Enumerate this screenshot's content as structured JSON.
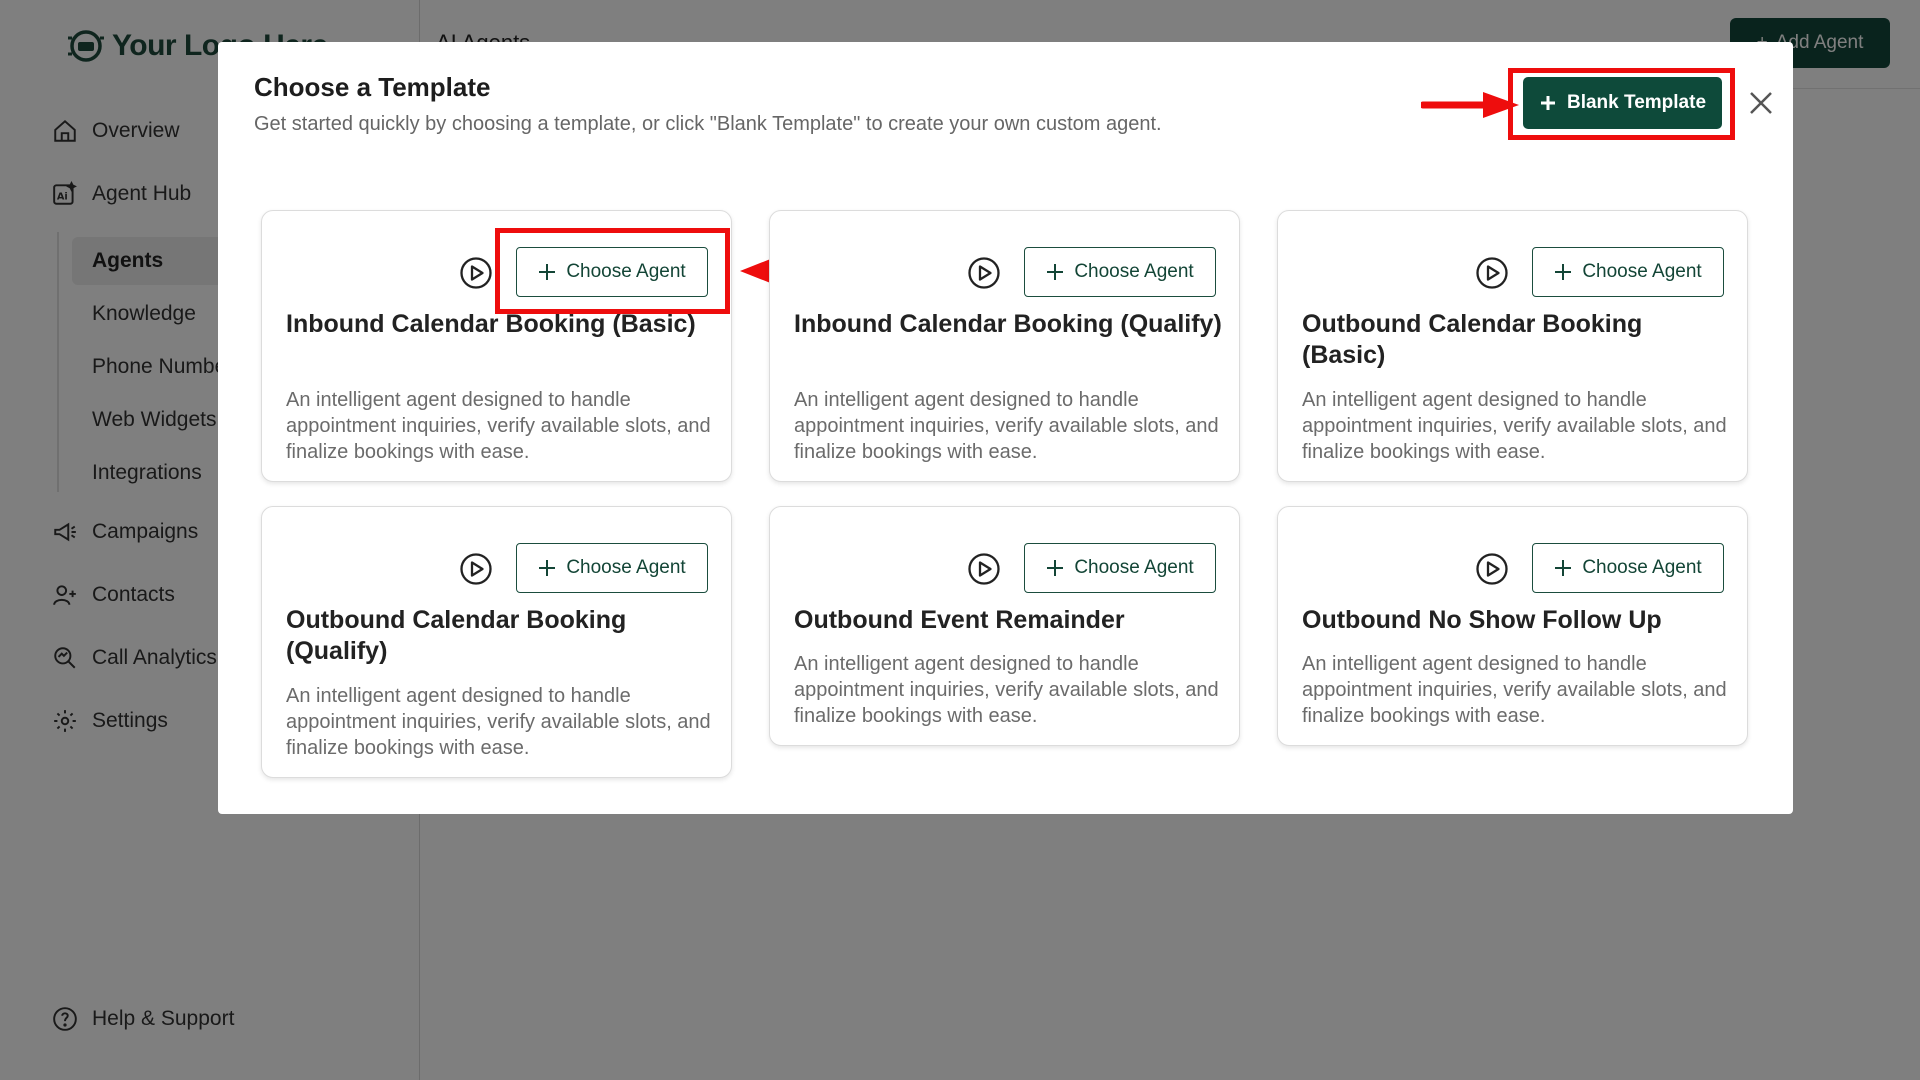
{
  "app": {
    "logo_text": "Your Logo Here",
    "page_title": "AI Agents",
    "add_agent_label": "Add Agent"
  },
  "sidebar": {
    "items": [
      {
        "label": "Overview",
        "icon": "home-icon"
      },
      {
        "label": "Agent Hub",
        "icon": "ai-icon"
      },
      {
        "label": "Campaigns",
        "icon": "megaphone-icon"
      },
      {
        "label": "Contacts",
        "icon": "user-add-icon"
      },
      {
        "label": "Call Analytics",
        "icon": "analytics-icon"
      },
      {
        "label": "Settings",
        "icon": "gear-icon"
      }
    ],
    "sub_items": [
      "Agents",
      "Knowledge",
      "Phone Numbers",
      "Web Widgets",
      "Integrations"
    ],
    "active_sub_item": "Agents",
    "help_label": "Help & Support"
  },
  "modal": {
    "title": "Choose a Template",
    "subtitle": "Get started quickly by choosing a template, or click \"Blank Template\" to create your own custom agent.",
    "blank_template_label": "Blank Template",
    "choose_label": "Choose Agent",
    "templates": [
      {
        "title": "Inbound Calendar Booking (Basic)",
        "description": "An intelligent agent designed to handle appointment inquiries, verify available slots, and finalize bookings with ease."
      },
      {
        "title": "Inbound Calendar Booking (Qualify)",
        "description": "An intelligent agent designed to handle appointment inquiries, verify available slots, and finalize bookings with ease."
      },
      {
        "title": "Outbound Calendar Booking (Basic)",
        "description": "An intelligent agent designed to handle appointment inquiries, verify available slots, and finalize bookings with ease."
      },
      {
        "title": "Outbound Calendar Booking (Qualify)",
        "description": "An intelligent agent designed to handle appointment inquiries, verify available slots, and finalize bookings with ease."
      },
      {
        "title": "Outbound Event Remainder",
        "description": "An intelligent agent designed to handle appointment inquiries, verify available slots, and finalize bookings with ease."
      },
      {
        "title": "Outbound No Show Follow Up",
        "description": "An intelligent agent designed to handle appointment inquiries, verify available slots, and finalize bookings with ease."
      }
    ]
  },
  "colors": {
    "brand_green": "#0e4a3a",
    "highlight_red": "#ee0d0d",
    "overlay": "rgba(0,0,0,0.5)"
  }
}
